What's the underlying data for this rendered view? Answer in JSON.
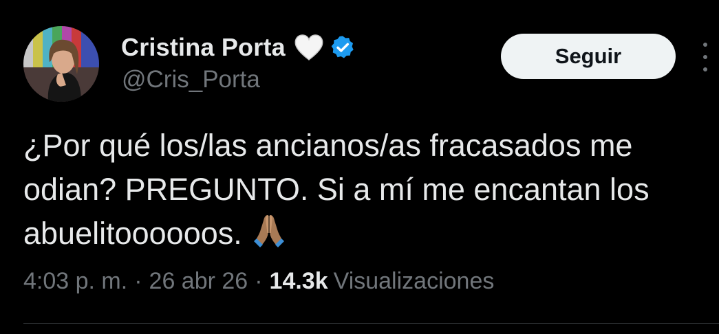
{
  "author": {
    "display_name": "Cristina Porta",
    "handle": "@Cris_Porta",
    "emoji_badge": "white-heart-icon",
    "verified_icon": "verified-badge-icon",
    "verified_color": "#1d9bf0"
  },
  "actions": {
    "follow_label": "Seguir",
    "more_icon": "more-options-icon"
  },
  "tweet": {
    "lines": [
      "¿Por qué los/las ancianos/as fracasados me",
      "odian? PREGUNTO. Si a mí me encantan los",
      "abuelitoooooos."
    ],
    "emoji": "folded-hands-icon"
  },
  "meta": {
    "time": "4:03 p. m.",
    "separator": "·",
    "date": "26 abr 26",
    "views_count": "14.3k",
    "views_label": "Visualizaciones"
  },
  "colors": {
    "background": "#000000",
    "text_primary": "#e7e9ea",
    "text_secondary": "#71767b",
    "button_bg": "#eff3f4",
    "button_text": "#0f1419"
  }
}
